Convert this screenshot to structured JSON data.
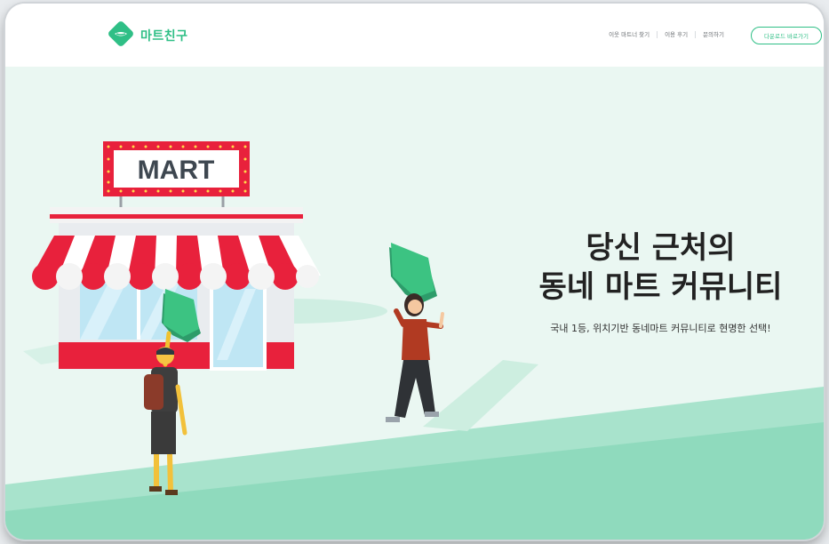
{
  "header": {
    "logo_text": "마트친구",
    "nav": [
      "이웃 마트너 찾기",
      "이용 후기",
      "문의하기"
    ],
    "download_label": "다운로드 바로가기"
  },
  "hero": {
    "headline_line1": "당신 근처의",
    "headline_line2": "동네 마트 커뮤니티",
    "subtitle": "국내 1등, 위치기반 동네마트 커뮤니티로 현명한 선택!",
    "store_sign": "MART"
  },
  "colors": {
    "brand_green": "#2fbf86",
    "awning_red": "#e8213c",
    "hero_bg": "#eaf7f2"
  }
}
